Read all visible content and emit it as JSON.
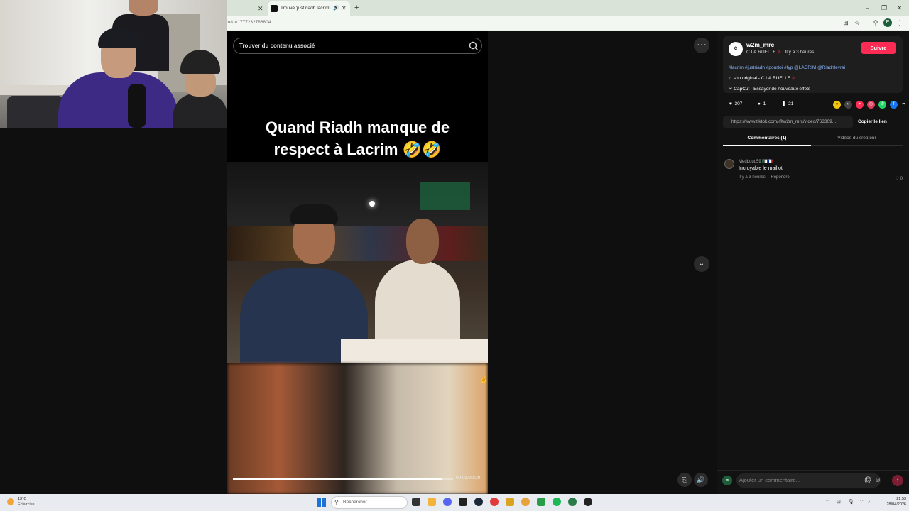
{
  "browser": {
    "tabs": [
      {
        "title": "",
        "active": false
      },
      {
        "title": "Trouvé 'just riadh lacrim' su",
        "active": true
      }
    ],
    "url_fragment": "m&t=1777232786804",
    "profile_letter": "E"
  },
  "video": {
    "search_placeholder": "Trouver du contenu associé",
    "caption_line1": "Quand Riadh manque de",
    "caption_line2": "respect à Lacrim 🤣🤣",
    "time": "00:03/00:20",
    "progress": 0.95
  },
  "post": {
    "username": "w2m_mrc",
    "nickname": "C LA.RUELLE",
    "posted": "· Il y a 3 heures",
    "follow_label": "Suivre",
    "hashtags": "#lacrim #justriadh #pourtoi #fyp @LACRIM @Riadhlevrai",
    "music": "son original - C LA.RUELLE",
    "capcut": "CapCut · Essayer de nouveaux effets",
    "likes": "307",
    "comments": "1",
    "saves": "21",
    "link": "https://www.tiktok.com/@w2m_mrc/video/763309...",
    "copy_label": "Copier le lien",
    "tab_comments": "Commentaires (1)",
    "tab_videos": "Vidéos du créateur"
  },
  "comments": [
    {
      "user": "Medbouu59 🇩🇿🇫🇷",
      "text": "Incroyable le maillot",
      "time": "Il y a 3 heures",
      "reply": "Répondre",
      "likes": "0"
    }
  ],
  "composer": {
    "placeholder": "Ajouter un commentaire...",
    "avatar": "E"
  },
  "taskbar": {
    "temp": "13°C",
    "condition": "Éclaircies",
    "search": "Rechercher",
    "time": "21:53",
    "date": "28/04/2026"
  }
}
